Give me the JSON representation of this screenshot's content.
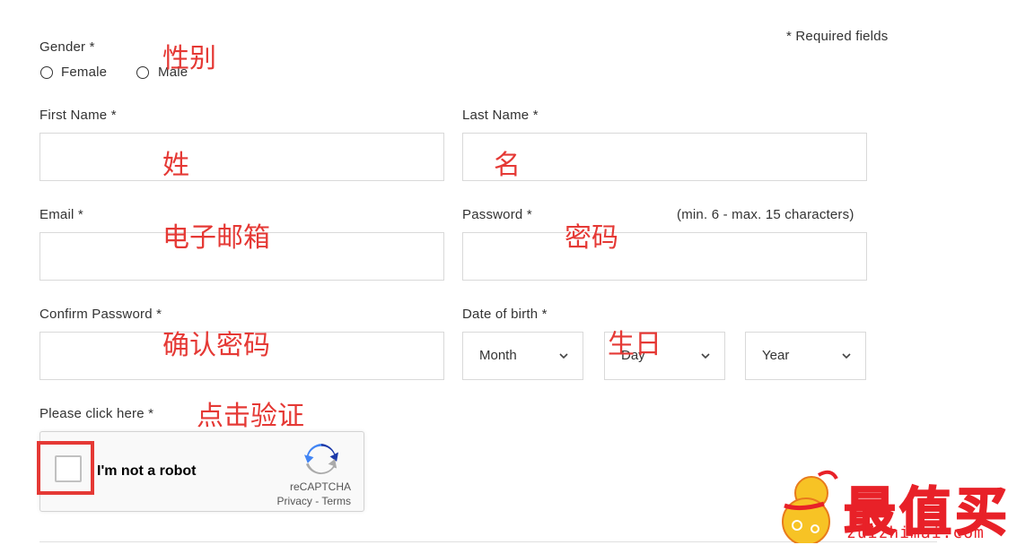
{
  "form": {
    "required_note": "* Required fields",
    "gender": {
      "label": "Gender *",
      "options": [
        "Female",
        "Male"
      ]
    },
    "first_name": {
      "label": "First Name *",
      "value": ""
    },
    "last_name": {
      "label": "Last Name *",
      "value": ""
    },
    "email": {
      "label": "Email *",
      "value": ""
    },
    "password": {
      "label": "Password *",
      "hint": "(min. 6 - max. 15 characters)",
      "value": ""
    },
    "confirm_password": {
      "label": "Confirm Password *",
      "value": ""
    },
    "dob": {
      "label": "Date of birth *",
      "month": "Month",
      "day": "Day",
      "year": "Year"
    },
    "captcha_label": "Please click here *"
  },
  "captcha": {
    "text": "I'm not a robot",
    "brand": "reCAPTCHA",
    "links": "Privacy - Terms"
  },
  "annotations": {
    "gender": "性别",
    "first_name": "姓",
    "last_name": "名",
    "email": "电子邮箱",
    "password": "密码",
    "confirm_password": "确认密码",
    "dob": "生日",
    "captcha": "点击验证"
  },
  "watermark": {
    "cn": "最值买",
    "en": "zuizhimai.com"
  },
  "colors": {
    "annotation": "#e53935",
    "brand": "#e82128",
    "border": "#d9d9d9"
  },
  "icons": {
    "select": "chevron-down-icon",
    "captcha": "recaptcha-logo-icon",
    "mascot": "gourd-mascot-icon"
  }
}
